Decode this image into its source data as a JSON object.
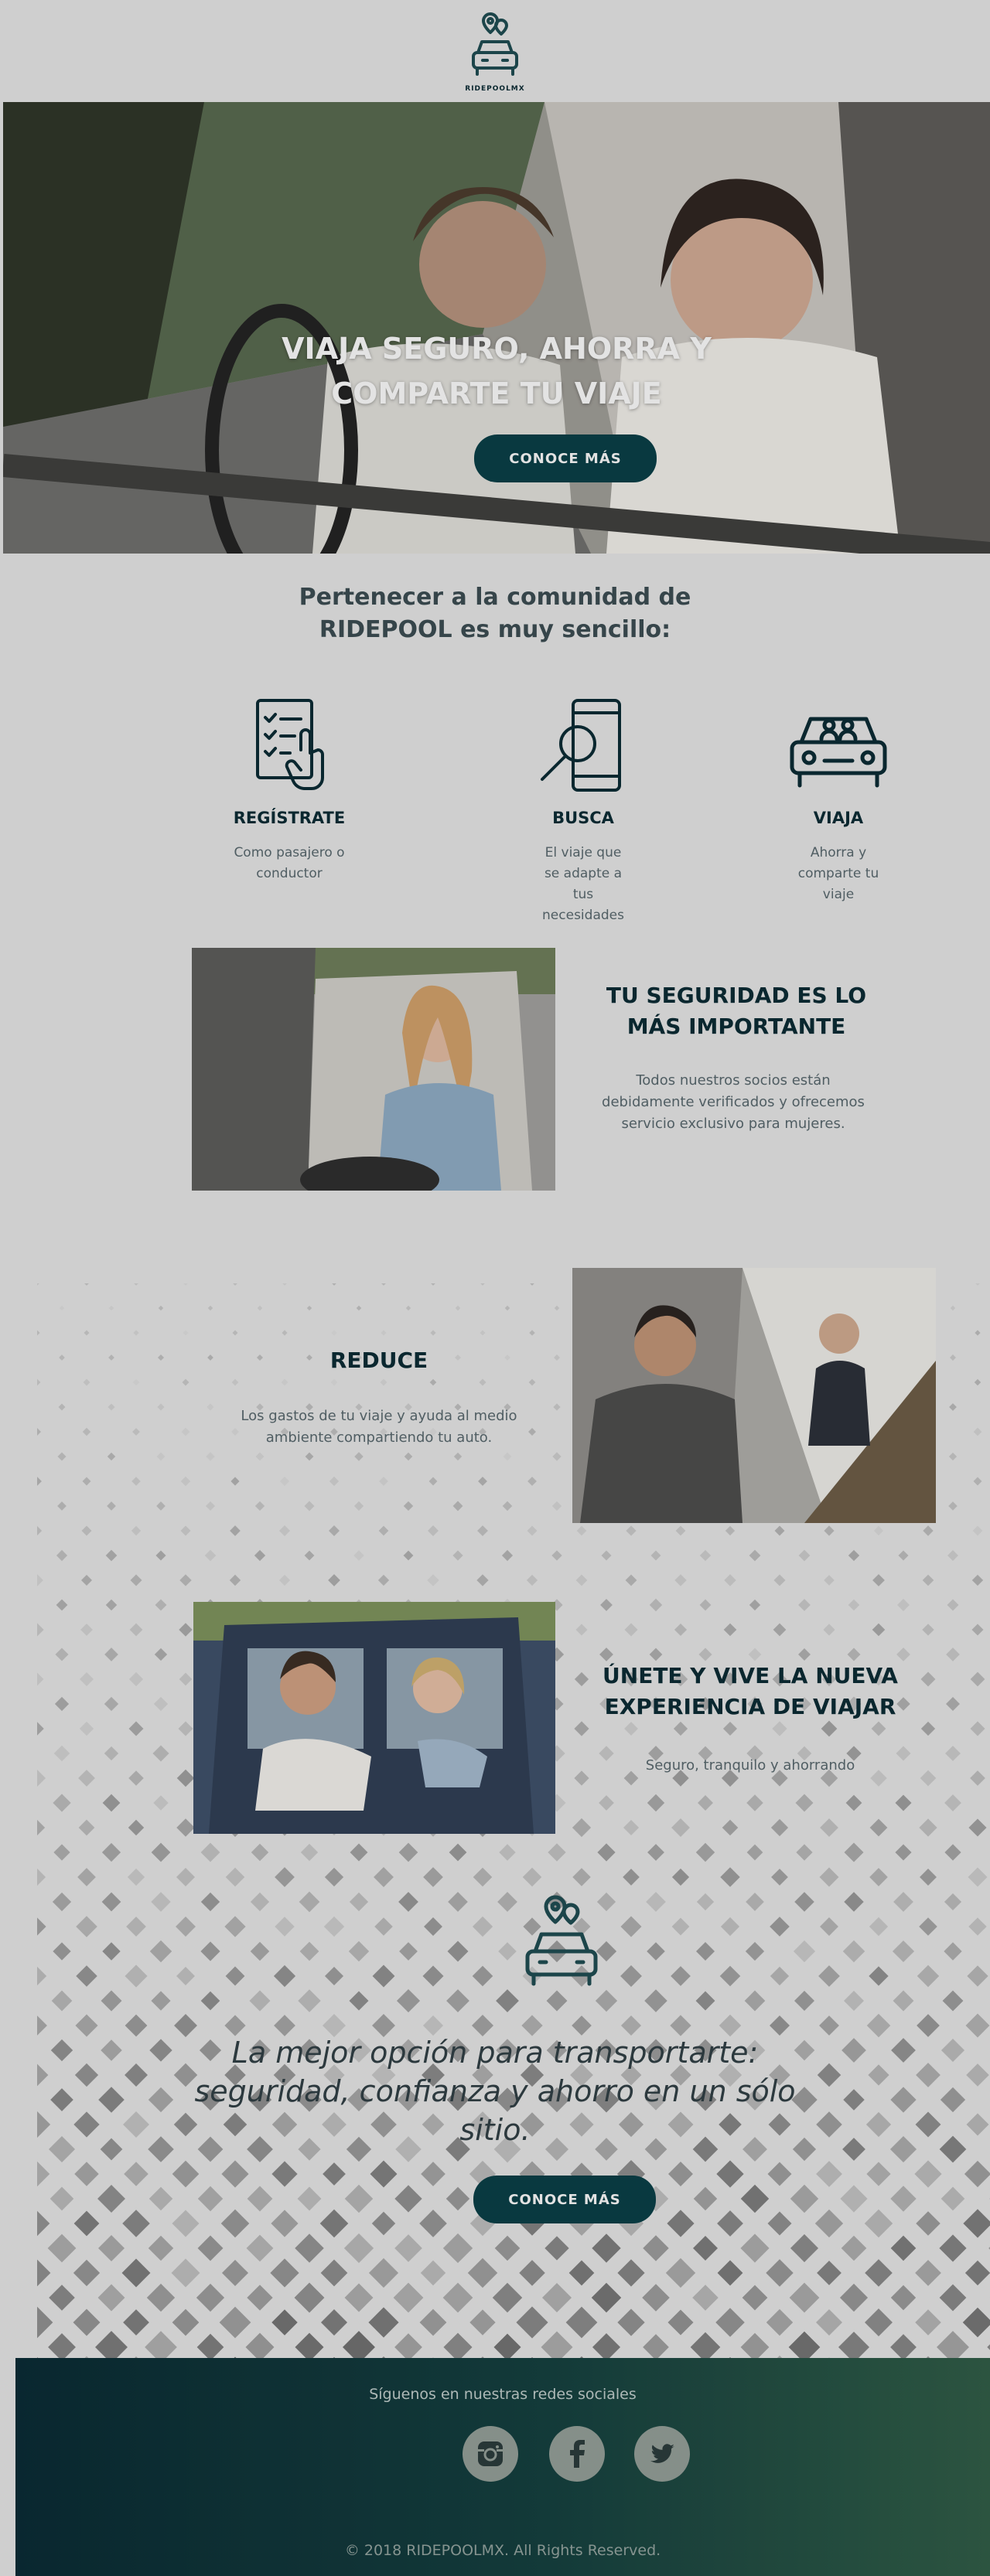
{
  "header": {
    "logo_text": "RIDEPOOLMX"
  },
  "hero": {
    "title": "VIAJA SEGURO, AHORRA Y COMPARTE TU VIAJE",
    "button": "CONOCE MÁS"
  },
  "community": {
    "title": "Pertenecer a la comunidad de RIDEPOOL es muy sencillo:",
    "steps": [
      {
        "icon": "checklist-hand-icon",
        "title": "REGÍSTRATE",
        "desc": "Como pasajero o conductor"
      },
      {
        "icon": "phone-search-icon",
        "title": "BUSCA",
        "desc": "El viaje que se adapte a tus necesidades"
      },
      {
        "icon": "car-passengers-icon",
        "title": "VIAJA",
        "desc": "Ahorra y comparte tu viaje"
      }
    ]
  },
  "features": [
    {
      "title": "TU SEGURIDAD ES LO MÁS IMPORTANTE",
      "desc": "Todos nuestros socios están debidamente verificados y ofrecemos servicio exclusivo para mujeres."
    },
    {
      "title": "REDUCE",
      "desc": "Los gastos de tu viaje y ayuda al medio ambiente compartiendo tu auto."
    },
    {
      "title": "ÚNETE Y VIVE LA NUEVA EXPERIENCIA DE VIAJAR",
      "desc": "Seguro, tranquilo y ahorrando"
    }
  ],
  "tagline": {
    "line1": "La mejor opción para transportarte:",
    "line2": "seguridad, confianza y ahorro en un sólo sitio.",
    "button": "CONOCE MÁS"
  },
  "footer": {
    "follow": "Síguenos en nuestras redes sociales",
    "social": [
      "instagram-icon",
      "facebook-icon",
      "twitter-icon"
    ],
    "copyright": "© 2018 RIDEPOOLMX. All Rights Reserved."
  },
  "colors": {
    "primary": "#0a3d44",
    "text": "#0b2a32",
    "muted": "#55646a",
    "footer_start": "#0a2a33",
    "footer_end": "#2f5a44"
  }
}
